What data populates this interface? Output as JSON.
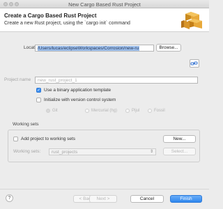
{
  "window": {
    "title": "New Cargo Based Rust Project"
  },
  "header": {
    "title": "Create a Cargo Based Rust Project",
    "description": "Create a new Rust project, using the `cargo init` command"
  },
  "location": {
    "label": "Location",
    "value": "/Users/lucas/eclipseWorkspaces/Corrosion/new-ru",
    "browse_label": "Browse..."
  },
  "project_name": {
    "label": "Project name",
    "placeholder": "new_rust_project_1"
  },
  "options": {
    "binary_template": "Use a binary application template",
    "vcs": "Initialize with version control system"
  },
  "vcs_options": [
    "Git",
    "Mercurial (hg)",
    "Pijul",
    "Fossil"
  ],
  "working_sets": {
    "group_title": "Working sets",
    "add_label": "Add project to working sets",
    "new_label": "New...",
    "sets_label": "Working sets:",
    "sets_value": "rust_projects",
    "select_label": "Select..."
  },
  "footer": {
    "help": "?",
    "back": "< Back",
    "next": "Next >",
    "cancel": "Cancel",
    "finish": "Finish"
  }
}
